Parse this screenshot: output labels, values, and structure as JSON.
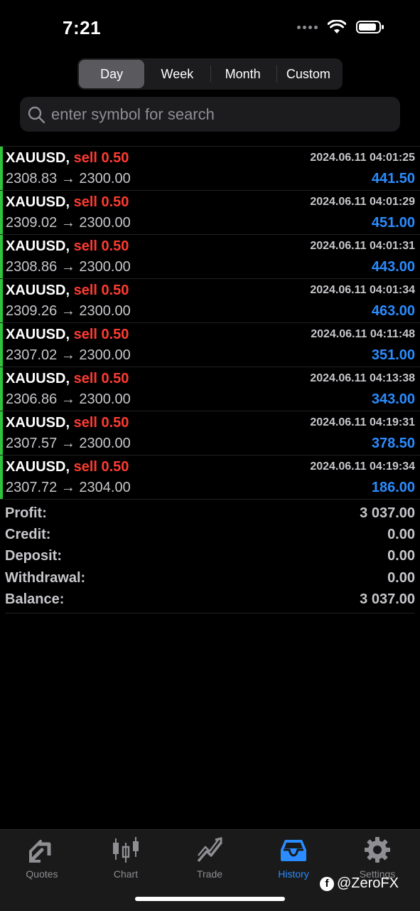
{
  "status_bar": {
    "time": "7:21"
  },
  "segments": [
    {
      "label": "Day",
      "active": true
    },
    {
      "label": "Week",
      "active": false
    },
    {
      "label": "Month",
      "active": false
    },
    {
      "label": "Custom",
      "active": false
    }
  ],
  "search": {
    "placeholder": "enter symbol for search",
    "value": ""
  },
  "deals": [
    {
      "symbol": "XAUUSD,",
      "side": "sell 0.50",
      "time": "2024.06.11 04:01:25",
      "prices": "2308.83 → 2300.00",
      "profit": "441.50"
    },
    {
      "symbol": "XAUUSD,",
      "side": "sell 0.50",
      "time": "2024.06.11 04:01:29",
      "prices": "2309.02 → 2300.00",
      "profit": "451.00"
    },
    {
      "symbol": "XAUUSD,",
      "side": "sell 0.50",
      "time": "2024.06.11 04:01:31",
      "prices": "2308.86 → 2300.00",
      "profit": "443.00"
    },
    {
      "symbol": "XAUUSD,",
      "side": "sell 0.50",
      "time": "2024.06.11 04:01:34",
      "prices": "2309.26 → 2300.00",
      "profit": "463.00"
    },
    {
      "symbol": "XAUUSD,",
      "side": "sell 0.50",
      "time": "2024.06.11 04:11:48",
      "prices": "2307.02 → 2300.00",
      "profit": "351.00"
    },
    {
      "symbol": "XAUUSD,",
      "side": "sell 0.50",
      "time": "2024.06.11 04:13:38",
      "prices": "2306.86 → 2300.00",
      "profit": "343.00"
    },
    {
      "symbol": "XAUUSD,",
      "side": "sell 0.50",
      "time": "2024.06.11 04:19:31",
      "prices": "2307.57 → 2300.00",
      "profit": "378.50"
    },
    {
      "symbol": "XAUUSD,",
      "side": "sell 0.50",
      "time": "2024.06.11 04:19:34",
      "prices": "2307.72 → 2304.00",
      "profit": "186.00"
    }
  ],
  "summary": [
    {
      "label": "Profit:",
      "value": "3 037.00"
    },
    {
      "label": "Credit:",
      "value": "0.00"
    },
    {
      "label": "Deposit:",
      "value": "0.00"
    },
    {
      "label": "Withdrawal:",
      "value": "0.00"
    },
    {
      "label": "Balance:",
      "value": "3 037.00"
    }
  ],
  "tabs": [
    {
      "label": "Quotes",
      "icon": "quotes-icon",
      "active": false
    },
    {
      "label": "Chart",
      "icon": "chart-icon",
      "active": false
    },
    {
      "label": "Trade",
      "icon": "trade-icon",
      "active": false
    },
    {
      "label": "History",
      "icon": "history-icon",
      "active": true
    },
    {
      "label": "Settings",
      "icon": "gear-icon",
      "active": false
    }
  ],
  "watermark": {
    "text": "@ZeroFX"
  },
  "colors": {
    "background": "#000000",
    "profit_blue": "#2b8cff",
    "sell_red": "#ff3b30",
    "buy_bar_green": "#2fc43c",
    "active_tab_blue": "#2b8cff"
  }
}
